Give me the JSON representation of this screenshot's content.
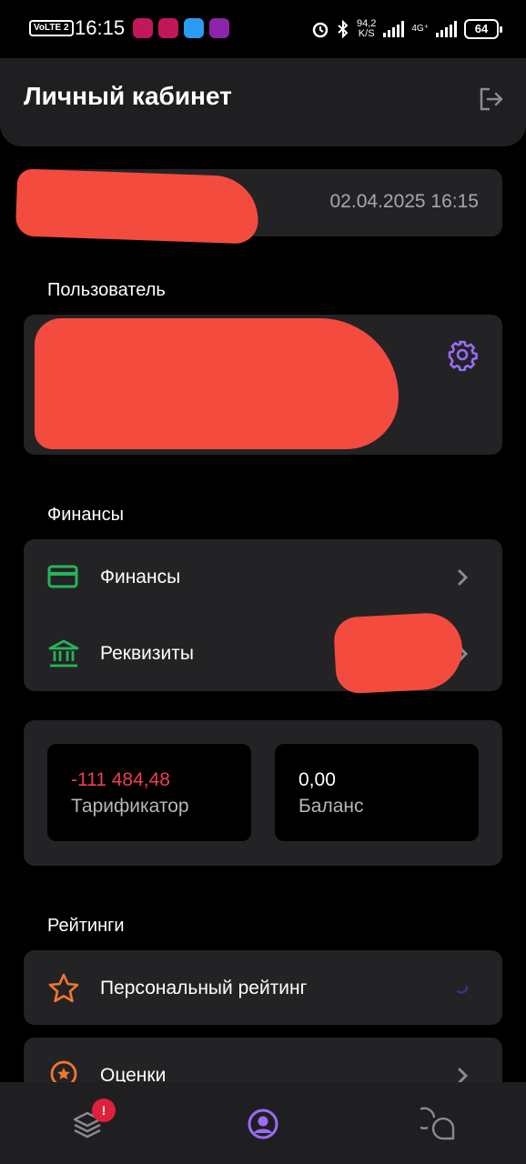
{
  "status_bar": {
    "volte": "VoLTE 2",
    "time": "16:15",
    "net_speed_value": "94,2",
    "net_speed_unit": "K/S",
    "net_type": "4G⁺",
    "battery": "64"
  },
  "header": {
    "title": "Личный кабинет"
  },
  "session_card": {
    "datetime": "02.04.2025 16:15"
  },
  "user_section": {
    "title": "Пользователь"
  },
  "finance_section": {
    "title": "Финансы",
    "items": [
      {
        "label": "Финансы",
        "icon": "credit-card-icon",
        "color": "#27b45a"
      },
      {
        "label": "Реквизиты",
        "icon": "bank-icon",
        "color": "#27b45a"
      }
    ]
  },
  "stats": {
    "tarificator": {
      "value": "-111 484,48",
      "label": "Тарификатор",
      "color": "#ef3d52"
    },
    "balance": {
      "value": "0,00",
      "label": "Баланс"
    }
  },
  "ratings_section": {
    "title": "Рейтинги",
    "items": [
      {
        "label": "Персональный рейтинг",
        "icon": "star-icon"
      },
      {
        "label": "Оценки",
        "icon": "star-circle-icon"
      }
    ]
  },
  "bottom_nav": {
    "items": [
      "layers-icon",
      "profile-icon",
      "chat-icon"
    ],
    "active": "profile-icon",
    "badge": "!"
  },
  "colors": {
    "accent": "#9b6cf6",
    "orange": "#f2782e",
    "green": "#27b45a",
    "negative": "#ef3d52",
    "redaction": "#f44b3f"
  }
}
